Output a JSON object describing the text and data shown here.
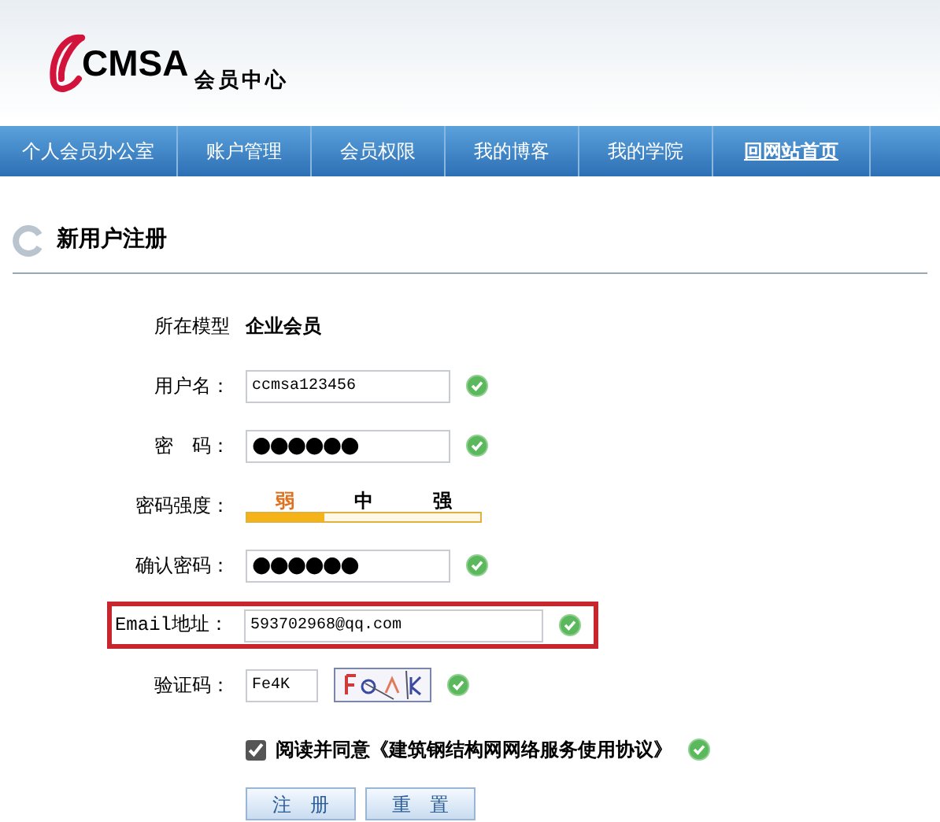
{
  "header": {
    "logo": "CMSA",
    "subtitle": "会员中心"
  },
  "nav": [
    {
      "label": "个人会员办公室",
      "kind": "tab"
    },
    {
      "label": "账户管理",
      "kind": "tab"
    },
    {
      "label": "会员权限",
      "kind": "tab"
    },
    {
      "label": "我的博客",
      "kind": "tab"
    },
    {
      "label": "我的学院",
      "kind": "tab"
    },
    {
      "label": "回网站首页",
      "kind": "link"
    }
  ],
  "page_title": "新用户注册",
  "form": [
    {
      "kind": "static",
      "label": "所在模型",
      "value": "企业会员"
    },
    {
      "kind": "input",
      "label": "用户名：",
      "value": "ccmsa123456",
      "valid": true
    },
    {
      "kind": "input",
      "label": "密　码：",
      "value": "●●●●●●",
      "valid": true,
      "mask": true
    },
    {
      "kind": "strength",
      "label": "密码强度：",
      "levels": [
        "弱",
        "中",
        "强"
      ],
      "level": 0.333
    },
    {
      "kind": "input",
      "label": "确认密码：",
      "value": "●●●●●●",
      "valid": true,
      "mask": true
    },
    {
      "kind": "input",
      "label": "Email地址：",
      "value": "593702968@qq.com",
      "valid": true,
      "highlighted": true,
      "wide": true
    },
    {
      "kind": "captcha",
      "label": "验证码：",
      "value": "Fe4K",
      "valid": true
    }
  ],
  "agreement": {
    "text": "阅读并同意《建筑钢结构网网络服务使用协议》",
    "checked": true,
    "valid": true
  },
  "buttons": [
    "注　册",
    "重　置"
  ]
}
